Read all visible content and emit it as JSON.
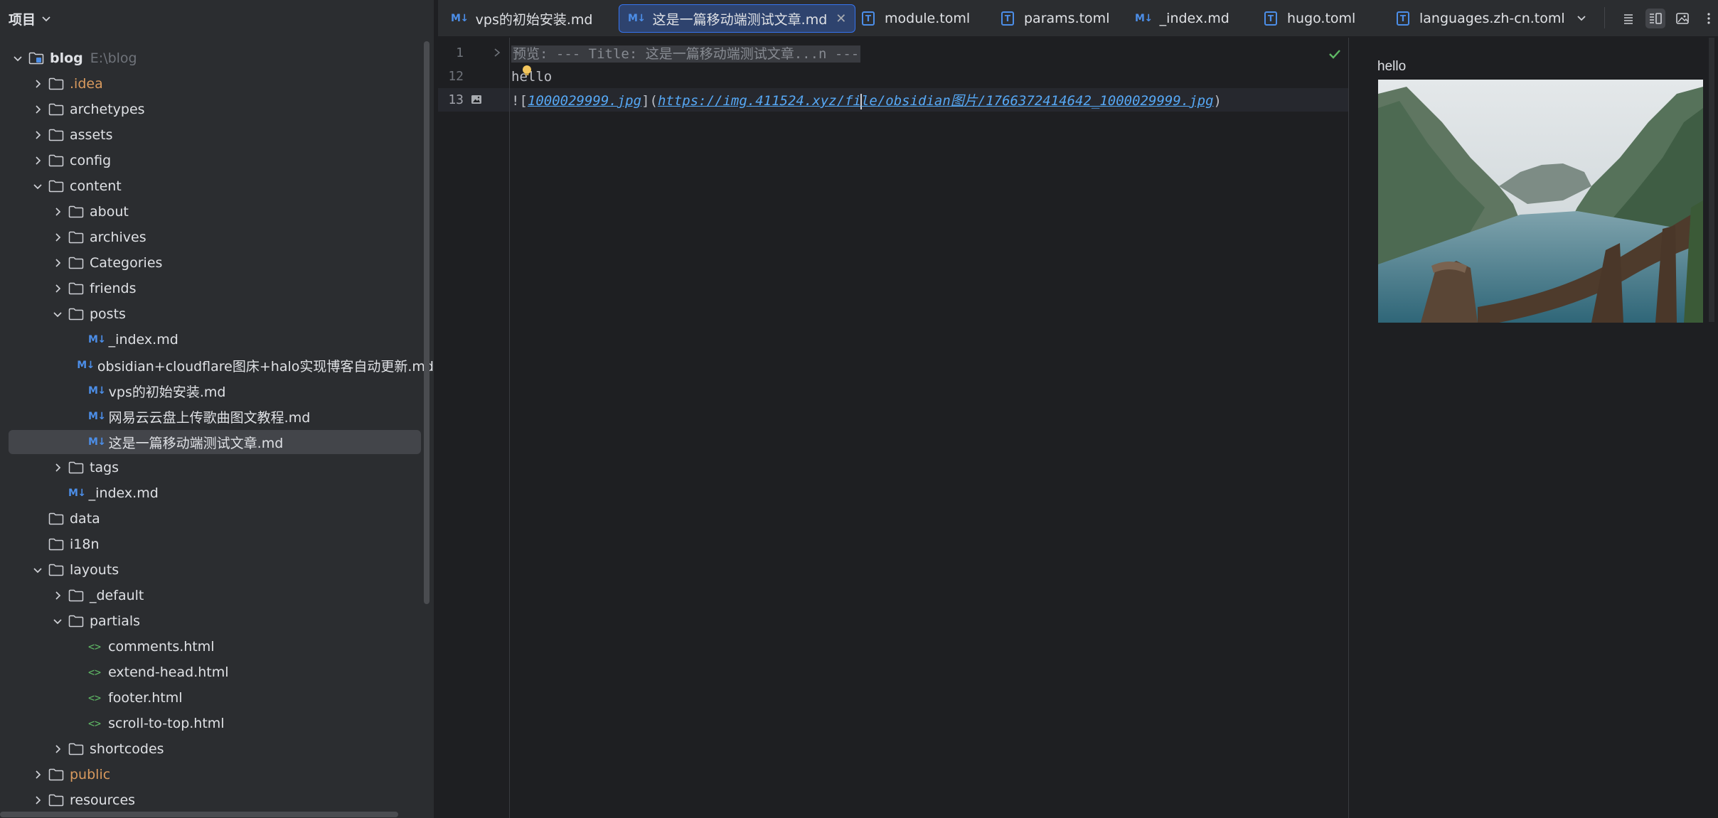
{
  "project": {
    "title": "项目",
    "tree": [
      {
        "label": "blog",
        "hint": "E:\\blog",
        "depth": 0,
        "kind": "module",
        "expanded": true,
        "bold": true
      },
      {
        "label": ".idea",
        "depth": 1,
        "kind": "folder",
        "expanded": false,
        "color": "orange"
      },
      {
        "label": "archetypes",
        "depth": 1,
        "kind": "folder",
        "expanded": false
      },
      {
        "label": "assets",
        "depth": 1,
        "kind": "folder",
        "expanded": false
      },
      {
        "label": "config",
        "depth": 1,
        "kind": "folder",
        "expanded": false
      },
      {
        "label": "content",
        "depth": 1,
        "kind": "folder",
        "expanded": true
      },
      {
        "label": "about",
        "depth": 2,
        "kind": "folder",
        "expanded": false
      },
      {
        "label": "archives",
        "depth": 2,
        "kind": "folder",
        "expanded": false
      },
      {
        "label": "Categories",
        "depth": 2,
        "kind": "folder",
        "expanded": false
      },
      {
        "label": "friends",
        "depth": 2,
        "kind": "folder",
        "expanded": false
      },
      {
        "label": "posts",
        "depth": 2,
        "kind": "folder",
        "expanded": true
      },
      {
        "label": "_index.md",
        "depth": 3,
        "kind": "md"
      },
      {
        "label": "obsidian+cloudflare图床+halo实现博客自动更新.md",
        "depth": 3,
        "kind": "md"
      },
      {
        "label": "vps的初始安装.md",
        "depth": 3,
        "kind": "md"
      },
      {
        "label": "网易云云盘上传歌曲图文教程.md",
        "depth": 3,
        "kind": "md"
      },
      {
        "label": "这是一篇移动端测试文章.md",
        "depth": 3,
        "kind": "md",
        "selected": true
      },
      {
        "label": "tags",
        "depth": 2,
        "kind": "folder",
        "expanded": false
      },
      {
        "label": "_index.md",
        "depth": 2,
        "kind": "md"
      },
      {
        "label": "data",
        "depth": 1,
        "kind": "folder",
        "leaf": true
      },
      {
        "label": "i18n",
        "depth": 1,
        "kind": "folder",
        "leaf": true
      },
      {
        "label": "layouts",
        "depth": 1,
        "kind": "folder",
        "expanded": true
      },
      {
        "label": "_default",
        "depth": 2,
        "kind": "folder",
        "expanded": false
      },
      {
        "label": "partials",
        "depth": 2,
        "kind": "folder",
        "expanded": true
      },
      {
        "label": "comments.html",
        "depth": 3,
        "kind": "html"
      },
      {
        "label": "extend-head.html",
        "depth": 3,
        "kind": "html"
      },
      {
        "label": "footer.html",
        "depth": 3,
        "kind": "html"
      },
      {
        "label": "scroll-to-top.html",
        "depth": 3,
        "kind": "html"
      },
      {
        "label": "shortcodes",
        "depth": 2,
        "kind": "folder",
        "expanded": false
      },
      {
        "label": "public",
        "depth": 1,
        "kind": "folder",
        "expanded": false,
        "color": "orange"
      },
      {
        "label": "resources",
        "depth": 1,
        "kind": "folder",
        "expanded": false
      }
    ]
  },
  "tabs": [
    {
      "label": "vps的初始安装.md",
      "kind": "md"
    },
    {
      "label": "这是一篇移动端测试文章.md",
      "kind": "md",
      "active": true
    },
    {
      "label": "module.toml",
      "kind": "toml"
    },
    {
      "label": "params.toml",
      "kind": "toml"
    },
    {
      "label": "_index.md",
      "kind": "md"
    },
    {
      "label": "hugo.toml",
      "kind": "toml"
    },
    {
      "label": "languages.zh-cn.toml",
      "kind": "toml"
    }
  ],
  "badges": {
    "md": "M↓",
    "toml": "T",
    "html": "<>"
  },
  "editor": {
    "lines": [
      {
        "num": "1",
        "folded": "预览: --- Title: 这是一篇移动端测试文章...n ---"
      },
      {
        "num": "12",
        "text": "hello"
      },
      {
        "num": "13",
        "bang": "!",
        "open_br": "[",
        "alt": "1000029999.jpg",
        "close_br": "]",
        "open_p": "(",
        "url_before_caret": "https://img.411524.xyz/fi",
        "url_after_caret": "le/obsidian图片/1766372414642_1000029999.jpg",
        "close_p": ")",
        "current": true
      }
    ]
  },
  "preview": {
    "text": "hello"
  },
  "colors": {
    "accent": "#3574f0",
    "md_icon": "#4c8ee8",
    "html_icon": "#5fb865",
    "excluded_folder": "#d99a5e",
    "link": "#56a8f5"
  }
}
